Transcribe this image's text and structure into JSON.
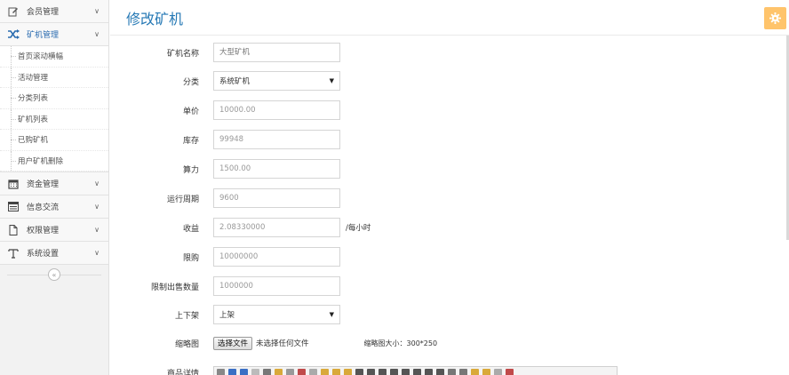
{
  "sidebar": {
    "items": [
      {
        "label": "会员管理",
        "icon": "edit-icon"
      },
      {
        "label": "矿机管理",
        "icon": "shuffle-icon"
      },
      {
        "label": "资金管理",
        "icon": "calendar-icon"
      },
      {
        "label": "信息交流",
        "icon": "list-icon"
      },
      {
        "label": "权限管理",
        "icon": "file-icon"
      },
      {
        "label": "系统设置",
        "icon": "text-icon"
      }
    ],
    "sub_items": [
      "首页滚动横幅",
      "活动管理",
      "分类列表",
      "矿机列表",
      "已购矿机",
      "用户矿机删除"
    ],
    "collapse_icon": "double-chevron-left-icon"
  },
  "header": {
    "title": "修改矿机",
    "settings_icon": "gear-icon"
  },
  "form": {
    "name": {
      "label": "矿机名称",
      "placeholder": "大型矿机"
    },
    "category": {
      "label": "分类",
      "value": "系统矿机"
    },
    "price": {
      "label": "单价",
      "value": "10000.00"
    },
    "stock": {
      "label": "库存",
      "value": "99948"
    },
    "hashrate": {
      "label": "算力",
      "value": "1500.00"
    },
    "period": {
      "label": "运行周期",
      "value": "9600"
    },
    "income": {
      "label": "收益",
      "value": "2.08330000",
      "unit": "/每小时"
    },
    "limit": {
      "label": "限购",
      "value": "10000000"
    },
    "sale_limit": {
      "label": "限制出售数量",
      "value": "1000000"
    },
    "status": {
      "label": "上下架",
      "value": "上架"
    },
    "thumbnail": {
      "label": "缩略图",
      "button": "选择文件",
      "file_text": "未选择任何文件",
      "hint": "缩略图大小：300*250"
    },
    "detail": {
      "label": "商品详情"
    }
  },
  "colors": {
    "accent": "#2679b5",
    "settings_bg": "#ffc46b"
  }
}
